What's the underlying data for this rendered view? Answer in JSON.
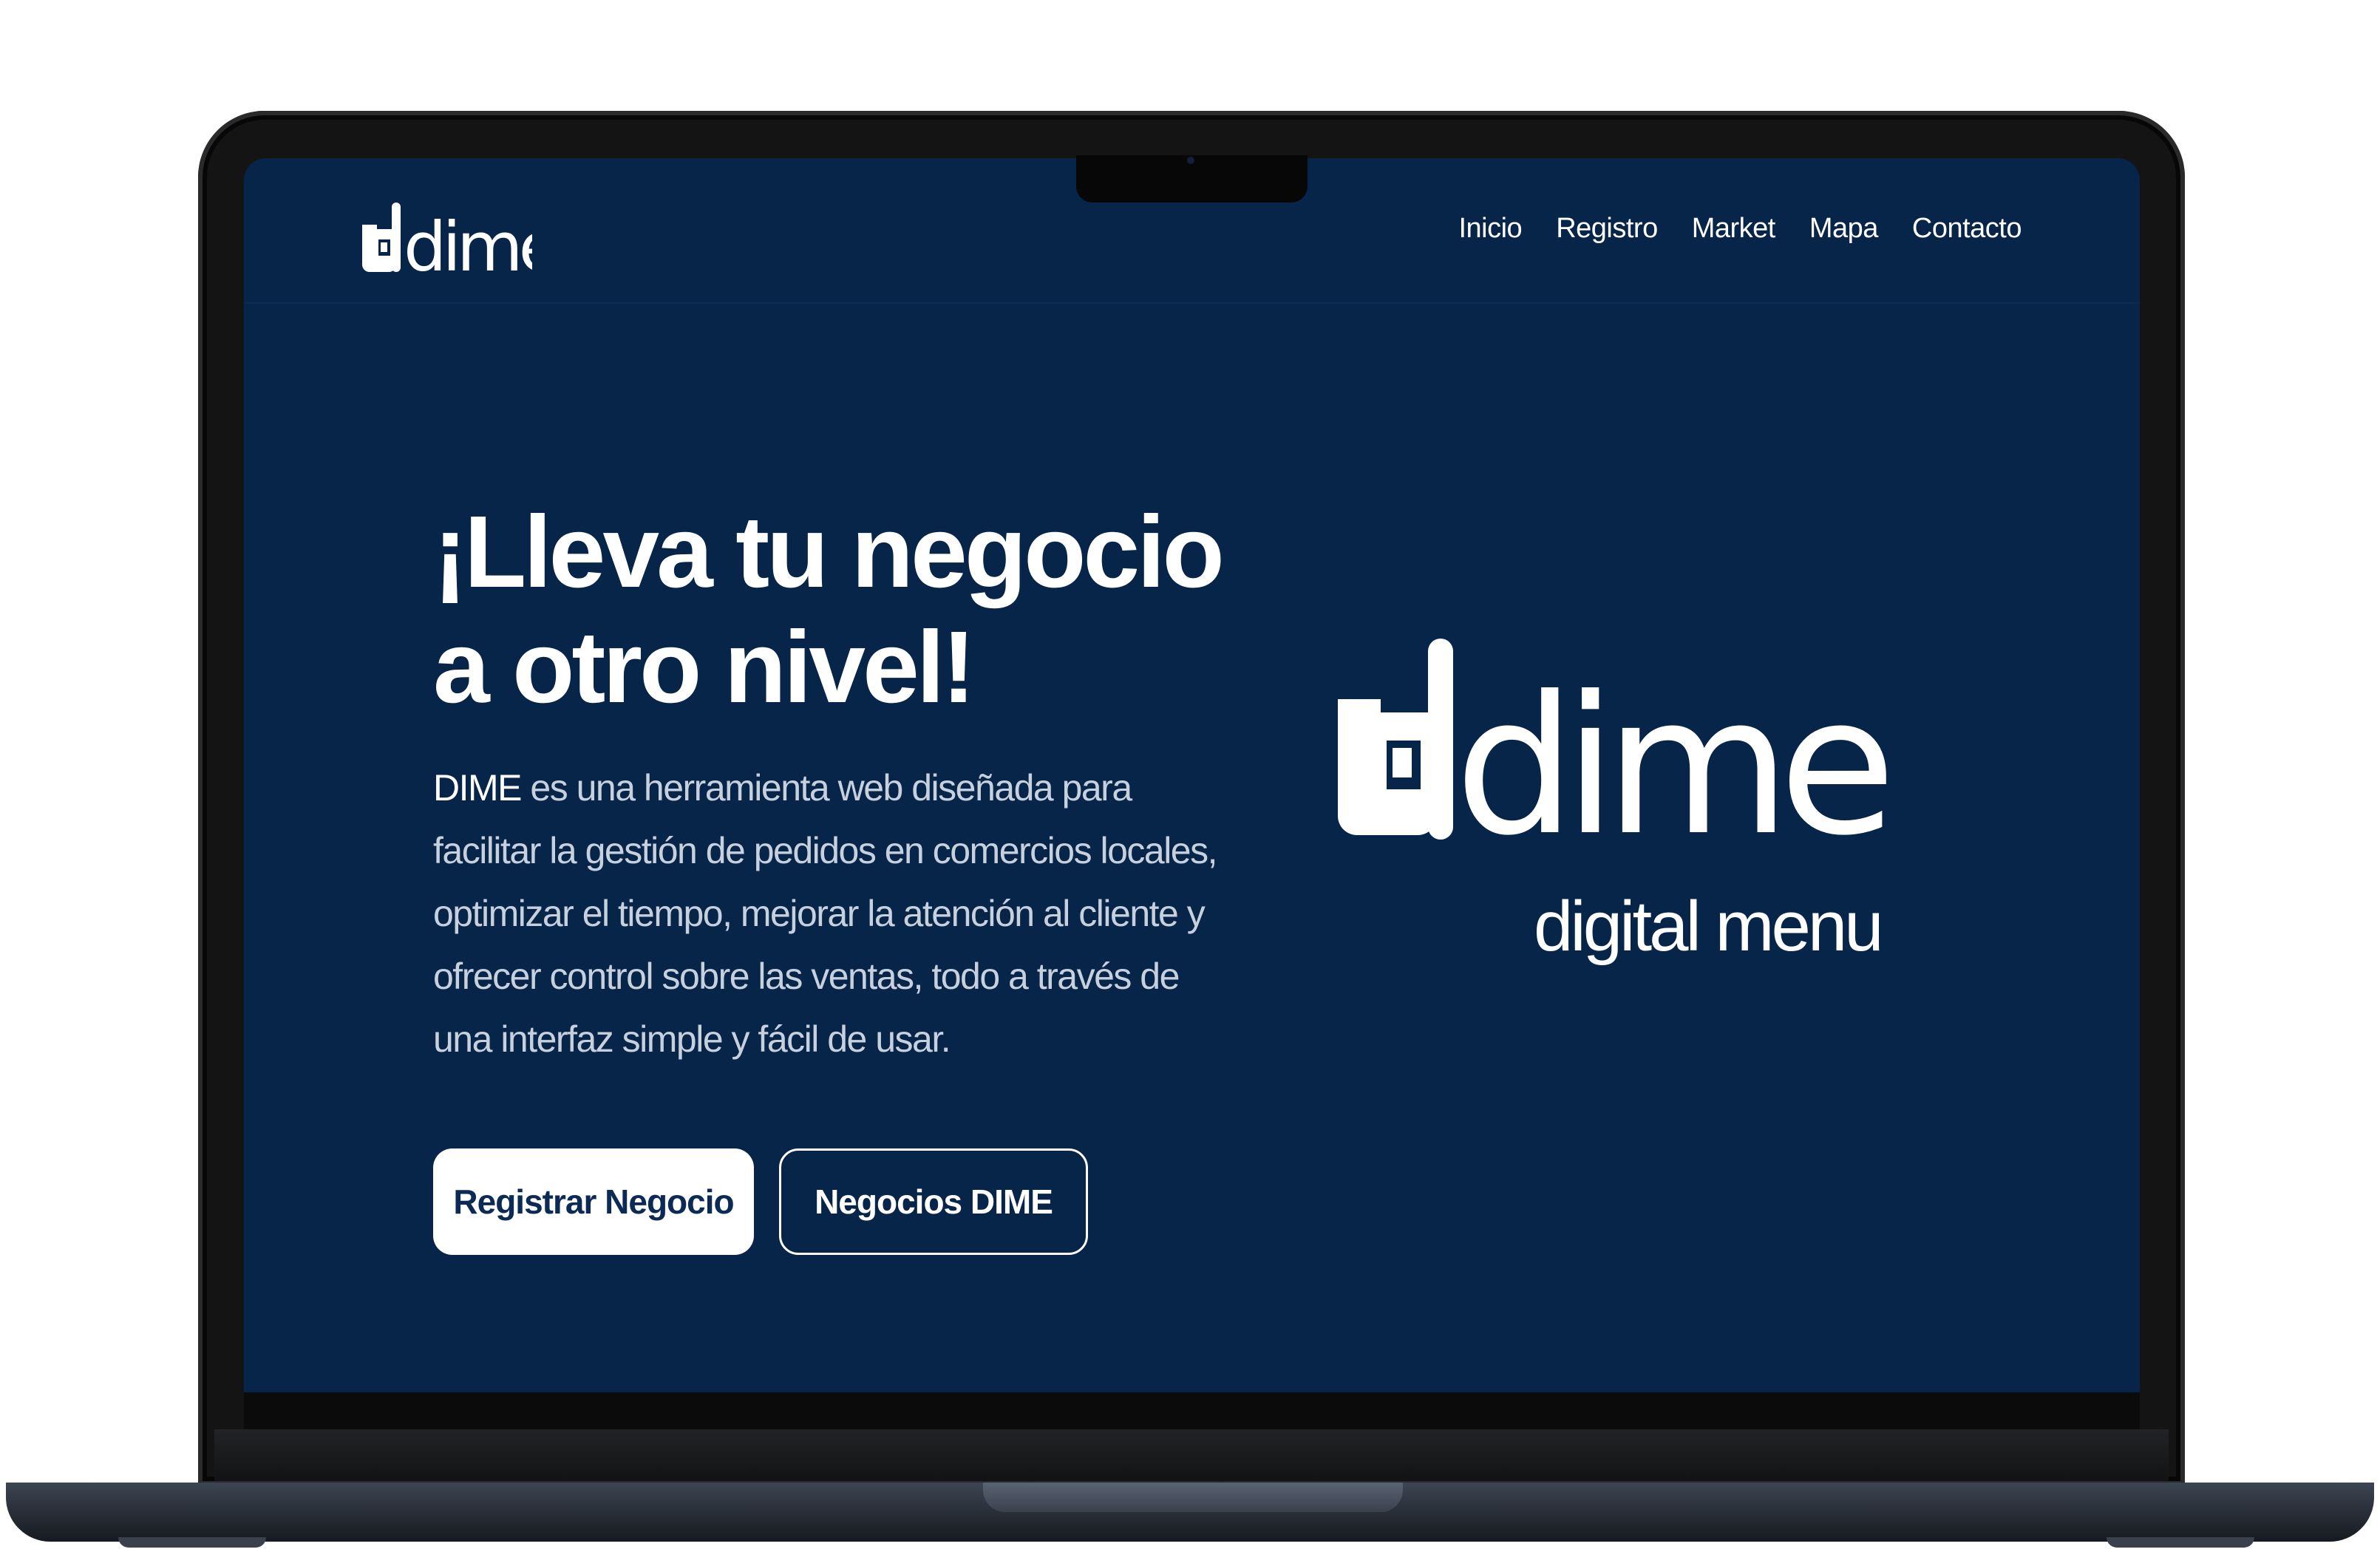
{
  "nav": {
    "logo_text": "dime",
    "links": [
      "Inicio",
      "Registro",
      "Market",
      "Mapa",
      "Contacto"
    ]
  },
  "hero": {
    "title": "¡Lleva tu negocio a otro nivel!",
    "brand_word": "DIME",
    "description": "es una herramienta web diseñada para facilitar la gestión de pedidos en comercios locales, optimizar el tiempo, mejorar la atención al cliente y ofrecer control sobre las ventas, todo a través de una interfaz simple y fácil de usar.",
    "primary_button": "Registrar Negocio",
    "secondary_button": "Negocios DIME",
    "logo_text": "dime",
    "logo_tagline": "digital menu"
  },
  "colors": {
    "background": "#072449",
    "text": "#ffffff",
    "button_text": "#0b2a55"
  }
}
